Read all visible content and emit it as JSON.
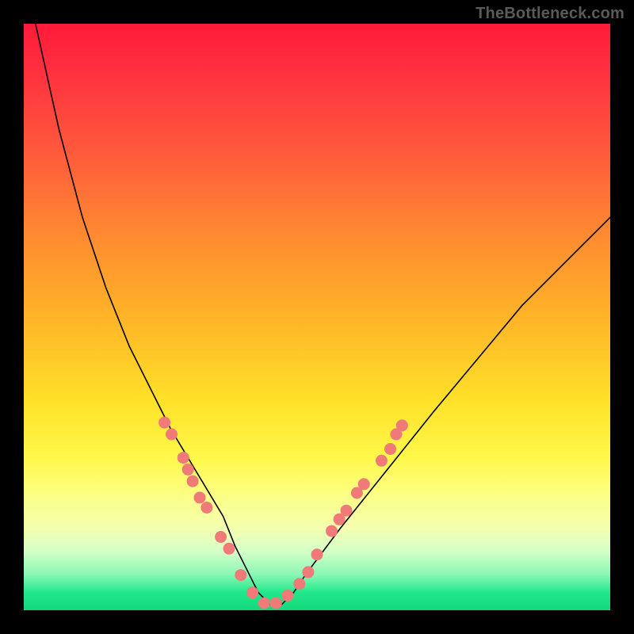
{
  "attribution": "TheBottleneck.com",
  "colors": {
    "gradient_top": "#ff1a3a",
    "gradient_bottom": "#14d87c",
    "curve": "#000000",
    "dots": "#ef7a78",
    "frame": "#000000"
  },
  "chart_data": {
    "type": "line",
    "title": "",
    "xlabel": "",
    "ylabel": "",
    "xlim": [
      0,
      100
    ],
    "ylim": [
      0,
      100
    ],
    "note": "Values read off the plot; y is plotted downward (0 at top, 100 at bottom). Curve is a V-shaped bottleneck profile with minimum near x≈40.",
    "series": [
      {
        "name": "curve",
        "x": [
          2,
          6,
          10,
          14,
          18,
          22,
          25,
          28,
          31,
          34,
          36,
          38,
          40,
          42,
          44,
          46,
          48,
          51,
          54,
          58,
          62,
          66,
          70,
          75,
          80,
          85,
          90,
          95,
          100
        ],
        "y": [
          0,
          18,
          33,
          45,
          55,
          63,
          69,
          74,
          79,
          84,
          89,
          93,
          97,
          99,
          99,
          97,
          94,
          90,
          86,
          81,
          76,
          71,
          66,
          60,
          54,
          48,
          43,
          38,
          33
        ]
      }
    ],
    "points": [
      {
        "x": 24.0,
        "y": 68.0
      },
      {
        "x": 25.2,
        "y": 70.0
      },
      {
        "x": 27.2,
        "y": 74.0
      },
      {
        "x": 28.0,
        "y": 76.0
      },
      {
        "x": 28.8,
        "y": 78.0
      },
      {
        "x": 30.0,
        "y": 80.8
      },
      {
        "x": 31.2,
        "y": 82.5
      },
      {
        "x": 33.6,
        "y": 87.5
      },
      {
        "x": 35.0,
        "y": 89.5
      },
      {
        "x": 37.0,
        "y": 94.0
      },
      {
        "x": 39.0,
        "y": 97.0
      },
      {
        "x": 41.0,
        "y": 98.8
      },
      {
        "x": 43.0,
        "y": 98.8
      },
      {
        "x": 45.0,
        "y": 97.5
      },
      {
        "x": 47.0,
        "y": 95.5
      },
      {
        "x": 48.5,
        "y": 93.5
      },
      {
        "x": 50.0,
        "y": 90.5
      },
      {
        "x": 52.5,
        "y": 86.5
      },
      {
        "x": 53.8,
        "y": 84.5
      },
      {
        "x": 55.0,
        "y": 83.0
      },
      {
        "x": 56.8,
        "y": 80.0
      },
      {
        "x": 58.0,
        "y": 78.5
      },
      {
        "x": 61.0,
        "y": 74.5
      },
      {
        "x": 62.5,
        "y": 72.5
      },
      {
        "x": 63.5,
        "y": 70.0
      },
      {
        "x": 64.5,
        "y": 68.5
      }
    ]
  }
}
